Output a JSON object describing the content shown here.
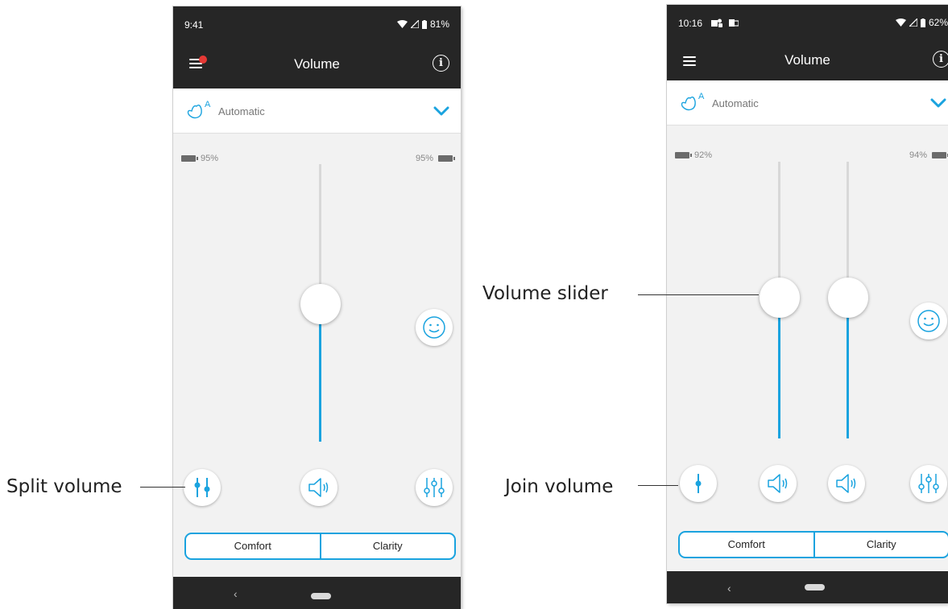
{
  "callouts": {
    "split_volume": "Split volume",
    "volume_slider": "Volume slider",
    "join_volume": "Join volume"
  },
  "left_phone": {
    "time": "9:41",
    "battery": "81%",
    "title": "Volume",
    "program": "Automatic",
    "left_battery": "95%",
    "right_battery": "95%",
    "volume_level": 0.53,
    "buttons": {
      "comfort": "Comfort",
      "clarity": "Clarity"
    }
  },
  "right_phone": {
    "time": "10:16",
    "battery": "62%",
    "title": "Volume",
    "program": "Automatic",
    "left_battery": "92%",
    "right_battery": "94%",
    "left_volume_level": 0.51,
    "right_volume_level": 0.51,
    "buttons": {
      "comfort": "Comfort",
      "clarity": "Clarity"
    }
  },
  "colors": {
    "accent": "#1aa3df",
    "bar": "#262626",
    "notification_dot": "#e53935"
  }
}
